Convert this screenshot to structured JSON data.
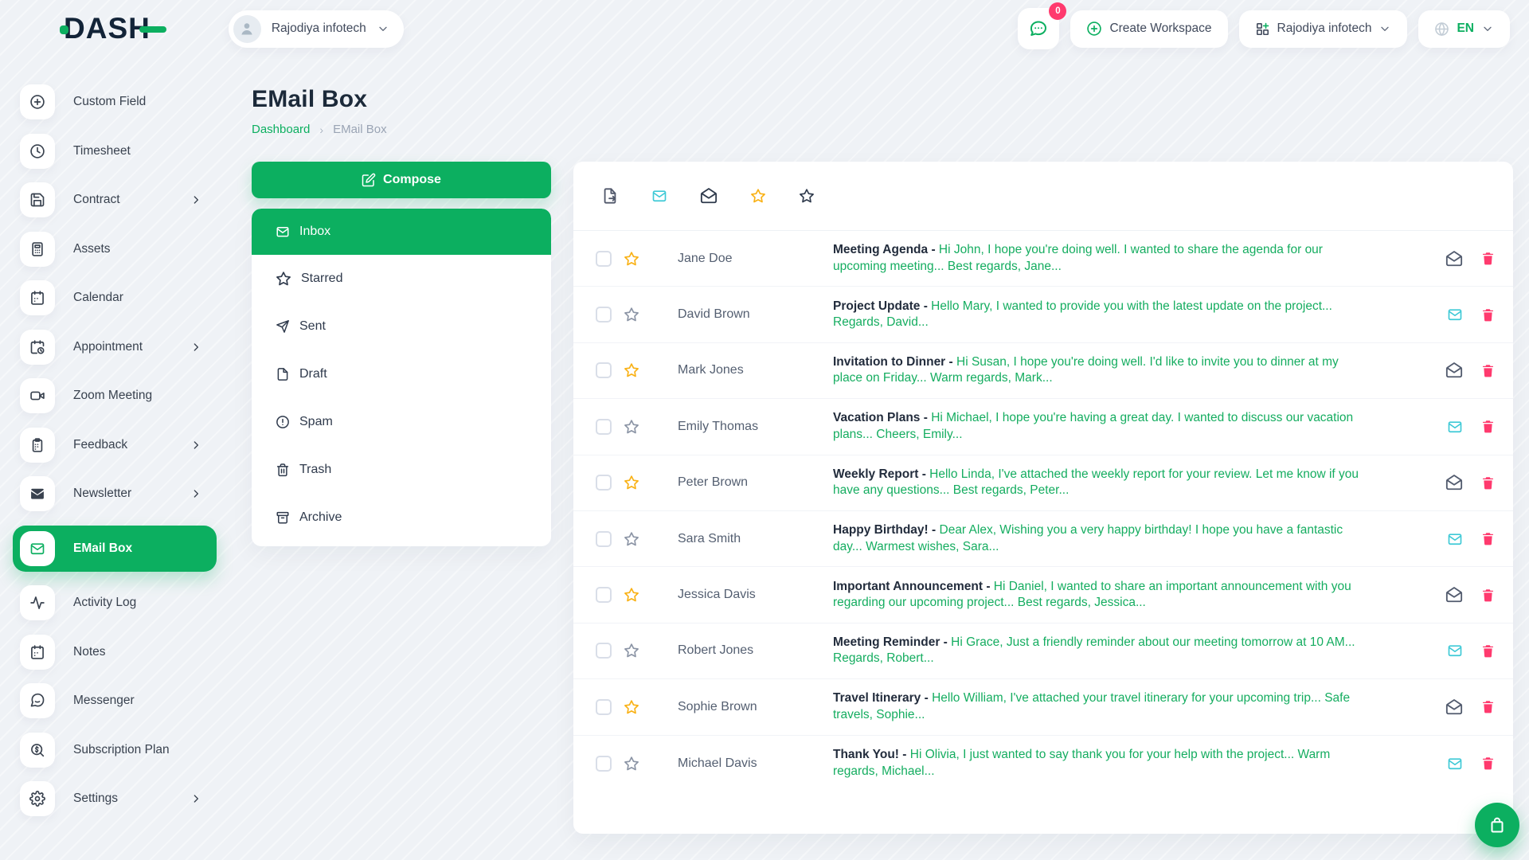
{
  "header": {
    "logo_text": "DASH",
    "workspace_switcher": {
      "label": "Rajodiya infotech"
    },
    "chat": {
      "badge": "0"
    },
    "create_workspace_label": "Create Workspace",
    "company_menu": {
      "label": "Rajodiya infotech"
    },
    "language": {
      "label": "EN"
    }
  },
  "sidebar": {
    "items": [
      {
        "label": "Custom Field",
        "icon": "plus-circle",
        "chevron": false,
        "active": false
      },
      {
        "label": "Timesheet",
        "icon": "clock",
        "chevron": false,
        "active": false
      },
      {
        "label": "Contract",
        "icon": "save",
        "chevron": true,
        "active": false
      },
      {
        "label": "Assets",
        "icon": "calculator",
        "chevron": false,
        "active": false
      },
      {
        "label": "Calendar",
        "icon": "calendar",
        "chevron": false,
        "active": false
      },
      {
        "label": "Appointment",
        "icon": "calendar-clock",
        "chevron": true,
        "active": false
      },
      {
        "label": "Zoom Meeting",
        "icon": "video",
        "chevron": false,
        "active": false
      },
      {
        "label": "Feedback",
        "icon": "clipboard",
        "chevron": true,
        "active": false
      },
      {
        "label": "Newsletter",
        "icon": "mail-filled",
        "chevron": true,
        "active": false
      },
      {
        "label": "EMail Box",
        "icon": "mail",
        "chevron": false,
        "active": true
      },
      {
        "label": "Activity Log",
        "icon": "activity",
        "chevron": false,
        "active": false
      },
      {
        "label": "Notes",
        "icon": "calendar",
        "chevron": false,
        "active": false
      },
      {
        "label": "Messenger",
        "icon": "message-circle",
        "chevron": false,
        "active": false
      },
      {
        "label": "Subscription Plan",
        "icon": "search-dollar",
        "chevron": false,
        "active": false
      },
      {
        "label": "Settings",
        "icon": "settings",
        "chevron": true,
        "active": false
      }
    ]
  },
  "page": {
    "title": "EMail Box",
    "breadcrumb": [
      {
        "label": "Dashboard",
        "link": true
      },
      {
        "label": "EMail Box",
        "link": false
      }
    ]
  },
  "mailbox": {
    "compose_label": "Compose",
    "subject_separator": " - ",
    "folders": [
      {
        "label": "Inbox",
        "icon": "inbox",
        "active": true
      },
      {
        "label": "Starred",
        "icon": "star",
        "active": false
      },
      {
        "label": "Sent",
        "icon": "send",
        "active": false
      },
      {
        "label": "Draft",
        "icon": "file",
        "active": false
      },
      {
        "label": "Spam",
        "icon": "alert-circle",
        "active": false
      },
      {
        "label": "Trash",
        "icon": "trash",
        "active": false
      },
      {
        "label": "Archive",
        "icon": "archive",
        "active": false
      }
    ],
    "toolbar": [
      {
        "icon": "file-export",
        "color": "#51586b"
      },
      {
        "icon": "mail",
        "color": "#3ec9d6"
      },
      {
        "icon": "mail-open",
        "color": "#2f3a4c"
      },
      {
        "icon": "star",
        "color": "#f9b115"
      },
      {
        "icon": "star",
        "color": "#2f3a4c"
      }
    ],
    "emails": [
      {
        "sender": "Jane Doe",
        "subject": "Meeting Agenda",
        "preview": "Hi John, I hope you're doing well. I wanted to share the agenda for our upcoming meeting... Best regards, Jane...",
        "starred": true,
        "read": true
      },
      {
        "sender": "David Brown",
        "subject": "Project Update",
        "preview": "Hello Mary, I wanted to provide you with the latest update on the project... Regards, David...",
        "starred": false,
        "read": false
      },
      {
        "sender": "Mark Jones",
        "subject": "Invitation to Dinner",
        "preview": "Hi Susan, I hope you're doing well. I'd like to invite you to dinner at my place on Friday... Warm regards, Mark...",
        "starred": true,
        "read": true
      },
      {
        "sender": "Emily Thomas",
        "subject": "Vacation Plans",
        "preview": "Hi Michael, I hope you're having a great day. I wanted to discuss our vacation plans... Cheers, Emily...",
        "starred": false,
        "read": false
      },
      {
        "sender": "Peter Brown",
        "subject": "Weekly Report",
        "preview": "Hello Linda, I've attached the weekly report for your review. Let me know if you have any questions... Best regards, Peter...",
        "starred": true,
        "read": true
      },
      {
        "sender": "Sara Smith",
        "subject": "Happy Birthday!",
        "preview": "Dear Alex, Wishing you a very happy birthday! I hope you have a fantastic day... Warmest wishes, Sara...",
        "starred": false,
        "read": false
      },
      {
        "sender": "Jessica Davis",
        "subject": "Important Announcement",
        "preview": "Hi Daniel, I wanted to share an important announcement with you regarding our upcoming project... Best regards, Jessica...",
        "starred": true,
        "read": true
      },
      {
        "sender": "Robert Jones",
        "subject": "Meeting Reminder",
        "preview": "Hi Grace, Just a friendly reminder about our meeting tomorrow at 10 AM... Regards, Robert...",
        "starred": false,
        "read": false
      },
      {
        "sender": "Sophie Brown",
        "subject": "Travel Itinerary",
        "preview": "Hello William, I've attached your travel itinerary for your upcoming trip... Safe travels, Sophie...",
        "starred": true,
        "read": true
      },
      {
        "sender": "Michael Davis",
        "subject": "Thank You!",
        "preview": "Hi Olivia, I just wanted to say thank you for your help with the project... Warm regards, Michael...",
        "starred": false,
        "read": false
      }
    ]
  },
  "colors": {
    "accent_green": "#0caf60",
    "info_cyan": "#3ec9d6",
    "warning_orange": "#f9b115",
    "danger_pink": "#ff3a6e"
  }
}
